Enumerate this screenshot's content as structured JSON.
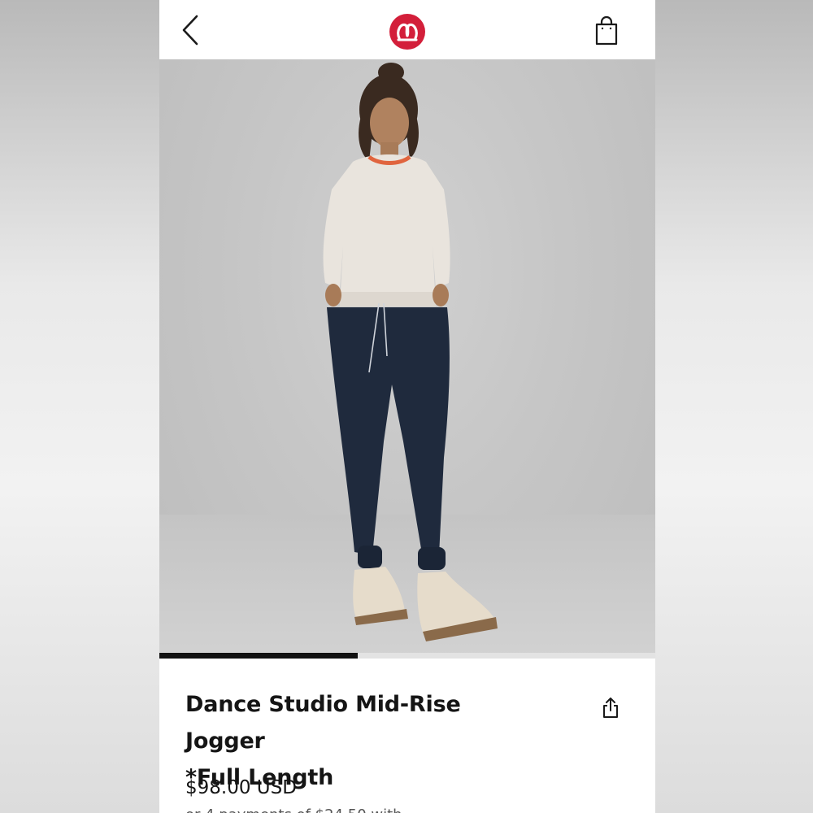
{
  "header": {
    "back_icon": "chevron-left-icon",
    "logo_icon": "lululemon-logo-icon",
    "bag_icon": "shopping-bag-icon",
    "brand_color": "#d31f3a"
  },
  "gallery": {
    "image_description": "product-photo-model-in-jogger",
    "progress": 0.4
  },
  "product": {
    "title_line1": "Dance Studio Mid-Rise Jogger",
    "title_line2": "*Full Length",
    "share_icon": "share-icon",
    "price": "$98.00 USD",
    "installment": "or 4 payments of $24.50 with"
  }
}
